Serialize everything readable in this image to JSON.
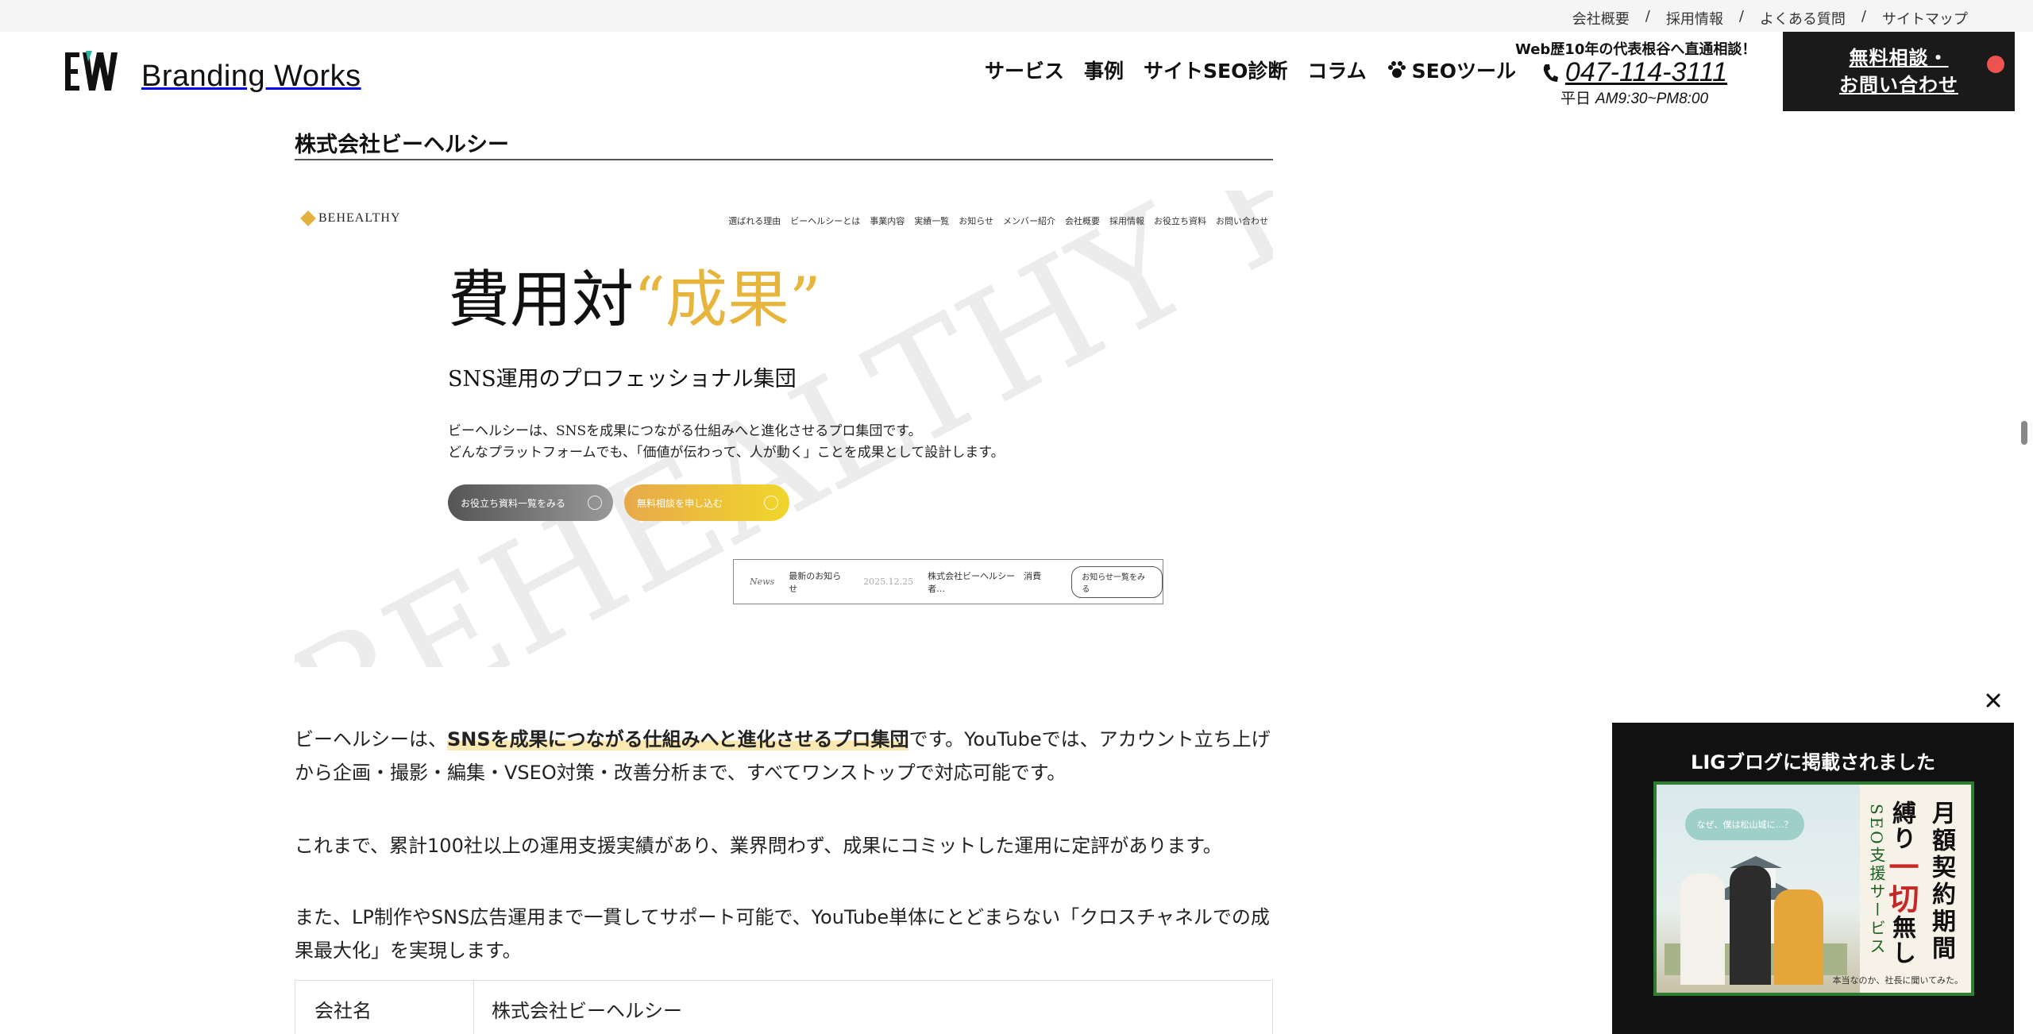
{
  "utility_nav": {
    "links": [
      "会社概要",
      "採用情報",
      "よくある質問",
      "サイトマップ"
    ],
    "separator": "/"
  },
  "header": {
    "brand": "Branding Works",
    "nav": [
      "サービス",
      "事例",
      "サイトSEO診断",
      "コラム",
      "SEOツール"
    ],
    "tel_lead": "Web歴10年の代表根谷へ直通相談！",
    "tel_number": "047-114-3111",
    "tel_hours_prefix": "平日",
    "tel_hours": "AM9:30~PM8:00",
    "cta_line1": "無料相談・",
    "cta_line2": "お問い合わせ"
  },
  "article": {
    "section_title": "株式会社ビーヘルシー",
    "screenshot": {
      "logo": "BEHEALTHY",
      "nav": [
        "選ばれる理由",
        "ビーヘルシーとは",
        "事業内容",
        "実績一覧",
        "お知らせ",
        "メンバー紹介",
        "会社概要",
        "採用情報",
        "お役立ち資料",
        "お問い合わせ"
      ],
      "title_main": "費用対",
      "title_accent": "“成果”",
      "subtitle": "SNS運用のプロフェッショナル集団",
      "desc_line1": "ビーヘルシーは、SNSを成果につながる仕組みへと進化させるプロ集団です。",
      "desc_line2": "どんなプラットフォームでも、「価値が伝わって、人が動く」ことを成果として設計します。",
      "btn1": "お役立ち資料一覧をみる",
      "btn2": "無料相談を申し込む",
      "news_label": "News",
      "news_latest": "最新のお知らせ",
      "news_date": "2025.12.25",
      "news_text": "株式会社ビーヘルシー　消費者…",
      "news_more": "お知らせ一覧をみる",
      "watermark": "BEHEALTHY B"
    },
    "p1_before": "ビーヘルシーは、",
    "p1_highlight": "SNSを成果につながる仕組みへと進化させるプロ集団",
    "p1_after": "です。YouTubeでは、アカウント立ち上げから企画・撮影・編集・VSEO対策・改善分析まで、すべてワンストップで対応可能です。",
    "p2": "これまで、累計100社以上の運用支援実績があり、業界問わず、成果にコミットした運用に定評があります。",
    "p3": "また、LP制作やSNS広告運用まで一貫してサポート可能で、YouTube単体にとどまらない「クロスチャネルでの成果最大化」を実現します。",
    "table": {
      "header": "会社名",
      "value": "株式会社ビーヘルシー"
    }
  },
  "popup": {
    "title": "LIGブログに掲載されました",
    "bubble": "なぜ、僕は松山城に…？",
    "vert_service": "SEO支援サービス",
    "vert_contract_pre": "縛り",
    "vert_contract_big": "一切",
    "vert_contract_post": "無し",
    "vert_monthly": "月額契約期間",
    "footer": "本当なのか、社長に聞いてみた。"
  },
  "colors": {
    "accent_gold": "#e7b53b",
    "cta_bg": "#1a1a1a",
    "highlight": "#fce9b1",
    "notify": "#ef5350"
  }
}
